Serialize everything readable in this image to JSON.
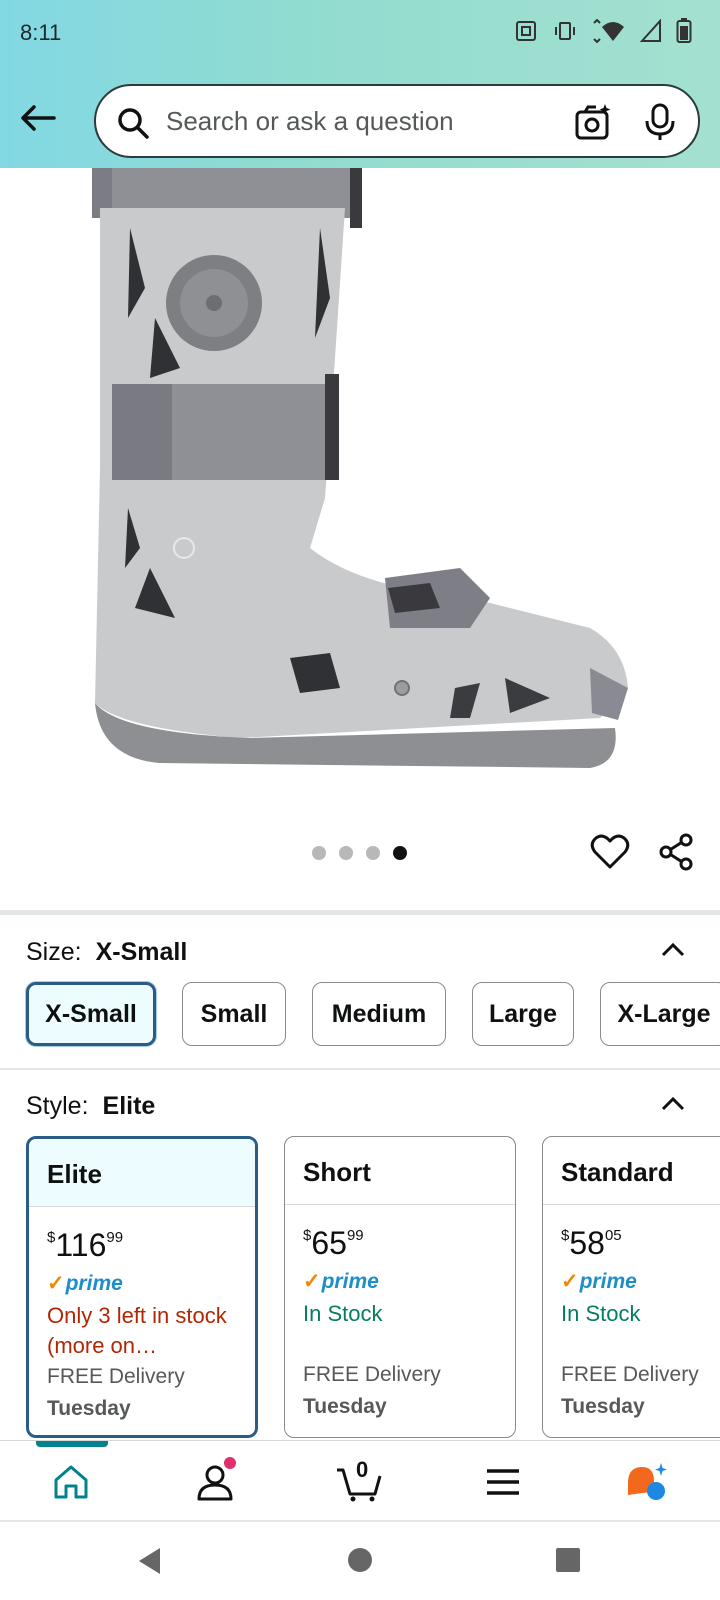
{
  "status_bar": {
    "time": "8:11"
  },
  "search": {
    "placeholder": "Search or ask a question"
  },
  "product": {
    "image_alt": "Walker boot product image",
    "carousel": {
      "count": 4,
      "active_index": 3
    }
  },
  "size": {
    "label": "Size:",
    "selected": "X-Small",
    "options": [
      "X-Small",
      "Small",
      "Medium",
      "Large",
      "X-Large"
    ]
  },
  "style": {
    "label": "Style:",
    "selected": "Elite",
    "options": [
      {
        "name": "Elite",
        "price_symbol": "$",
        "price_whole": "116",
        "price_fraction": "99",
        "prime": "prime",
        "stock": "Only 3 left in stock (more on…",
        "stock_kind": "low",
        "delivery": "FREE Delivery",
        "delivery_day": "Tuesday"
      },
      {
        "name": "Short",
        "price_symbol": "$",
        "price_whole": "65",
        "price_fraction": "99",
        "prime": "prime",
        "stock": "In Stock",
        "stock_kind": "ok",
        "delivery": "FREE Delivery",
        "delivery_day": "Tuesday"
      },
      {
        "name": "Standard",
        "price_symbol": "$",
        "price_whole": "58",
        "price_fraction": "05",
        "prime": "prime",
        "stock": "In Stock",
        "stock_kind": "ok",
        "delivery": "FREE Delivery",
        "delivery_day": "Tuesday"
      }
    ]
  },
  "bottom_nav": {
    "cart_count": "0"
  },
  "colors": {
    "accent": "#00838f",
    "selected_border": "#2b5c87",
    "prime_blue": "#1f8ec8",
    "low_stock": "#b12704",
    "in_stock": "#067d62"
  }
}
